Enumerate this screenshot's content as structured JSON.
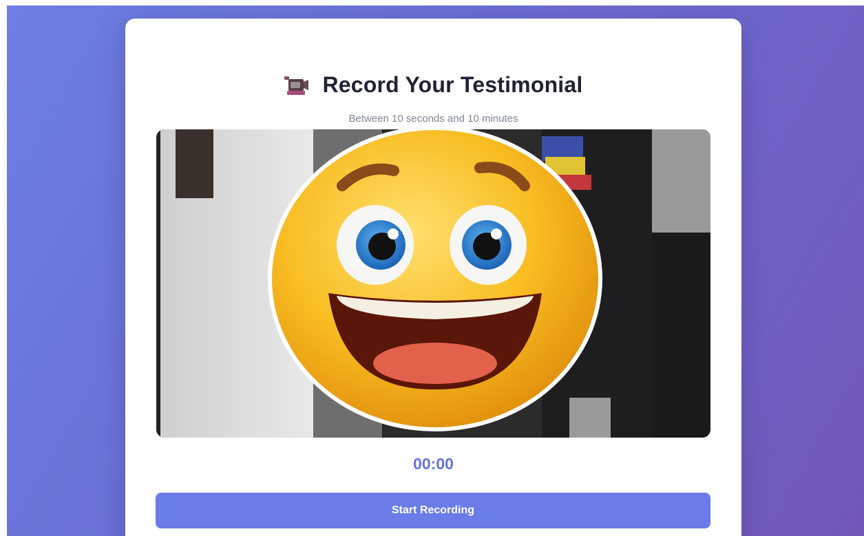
{
  "header": {
    "icon": "video-camera-icon",
    "title": "Record Your Testimonial",
    "subtitle": "Between 10 seconds and 10 minutes"
  },
  "preview": {
    "overlay_icon": "smiling-face-icon"
  },
  "timer": {
    "value": "00:00"
  },
  "actions": {
    "start_label": "Start Recording"
  },
  "colors": {
    "accent": "#6a7ce8",
    "timer": "#6572e0",
    "title": "#1f2333",
    "subtitle": "#7d8494"
  }
}
